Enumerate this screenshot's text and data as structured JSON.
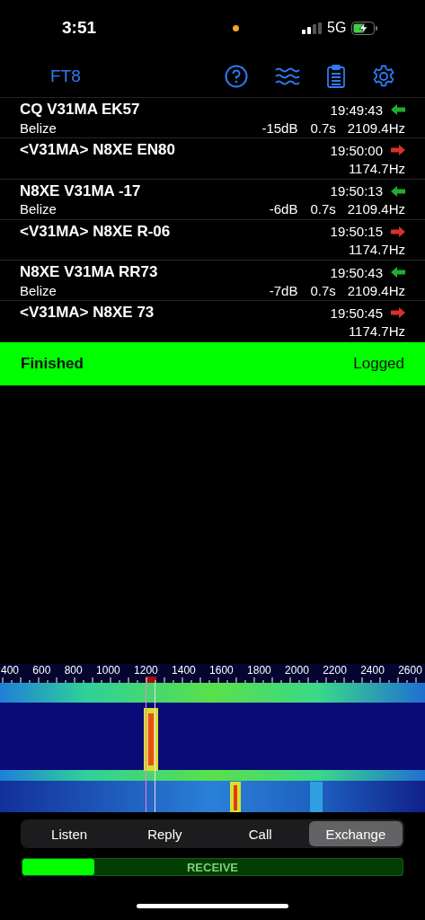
{
  "status_bar": {
    "time": "3:51",
    "network": "5G"
  },
  "nav": {
    "title": "FT8"
  },
  "messages": [
    {
      "kind": "rx",
      "text": "CQ V31MA EK57",
      "time": "19:49:43",
      "country": "Belize",
      "snr": "-15dB",
      "dt": "0.7s",
      "freq": "2109.4Hz"
    },
    {
      "kind": "tx",
      "text": "<V31MA> N8XE EN80",
      "time": "19:50:00",
      "freq": "1174.7Hz"
    },
    {
      "kind": "rx",
      "text": "N8XE V31MA -17",
      "time": "19:50:13",
      "country": "Belize",
      "snr": "-6dB",
      "dt": "0.7s",
      "freq": "2109.4Hz"
    },
    {
      "kind": "tx",
      "text": "<V31MA> N8XE R-06",
      "time": "19:50:15",
      "freq": "1174.7Hz"
    },
    {
      "kind": "rx",
      "text": "N8XE V31MA RR73",
      "time": "19:50:43",
      "country": "Belize",
      "snr": "-7dB",
      "dt": "0.7s",
      "freq": "2109.4Hz"
    },
    {
      "kind": "tx",
      "text": "<V31MA> N8XE 73",
      "time": "19:50:45",
      "freq": "1174.7Hz"
    }
  ],
  "status_banner": {
    "left": "Finished",
    "right": "Logged"
  },
  "frequency_scale": [
    "400",
    "600",
    "800",
    "1000",
    "1200",
    "1400",
    "1600",
    "1800",
    "2000",
    "2200",
    "2400",
    "2600"
  ],
  "modes": [
    {
      "label": "Listen",
      "selected": false
    },
    {
      "label": "Reply",
      "selected": false
    },
    {
      "label": "Call",
      "selected": false
    },
    {
      "label": "Exchange",
      "selected": true
    }
  ],
  "progress": {
    "label": "RECEIVE",
    "level": 0.19
  }
}
